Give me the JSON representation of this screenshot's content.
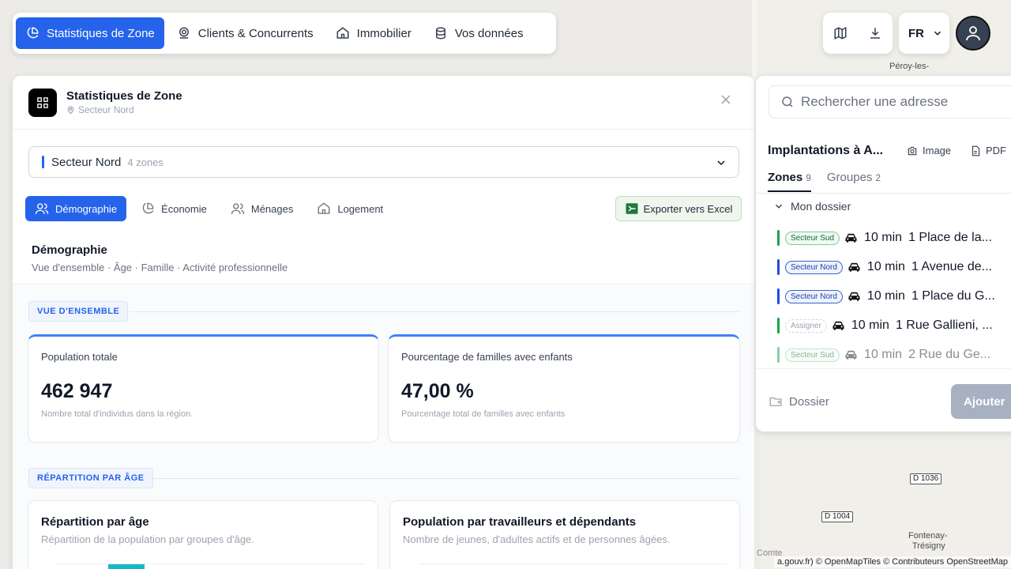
{
  "nav": {
    "items": [
      {
        "label": "Statistiques de Zone",
        "icon": "pie-chart-icon",
        "active": true
      },
      {
        "label": "Clients & Concurrents",
        "icon": "map-pin-icon",
        "active": false
      },
      {
        "label": "Immobilier",
        "icon": "home-icon",
        "active": false
      },
      {
        "label": "Vos données",
        "icon": "database-icon",
        "active": false
      }
    ]
  },
  "toolbar": {
    "map_icon": "map-icon",
    "download_icon": "download-icon",
    "language": "FR",
    "user_icon": "user-icon"
  },
  "panel": {
    "title": "Statistiques de Zone",
    "subtitle": "Secteur Nord",
    "zone_select": {
      "name": "Secteur Nord",
      "count": "4 zones"
    },
    "tabs": [
      {
        "label": "Démographie",
        "icon": "users-icon",
        "active": true
      },
      {
        "label": "Économie",
        "icon": "pie-chart-icon",
        "active": false
      },
      {
        "label": "Ménages",
        "icon": "users-icon",
        "active": false
      },
      {
        "label": "Logement",
        "icon": "home-icon",
        "active": false
      }
    ],
    "export_label": "Exporter vers Excel",
    "section": {
      "title": "Démographie",
      "subtitle": "Vue d'ensemble · Âge · Famille · Activité professionnelle"
    },
    "overview_chip": "VUE D'ENSEMBLE",
    "cards": [
      {
        "label": "Population totale",
        "value": "462 947",
        "desc": "Nombre total d'individus dans la région."
      },
      {
        "label": "Pourcentage de familles avec enfants",
        "value": "47,00 %",
        "desc": "Pourcentage total de familles avec enfants"
      }
    ],
    "age_chip": "RÉPARTITION PAR ÂGE",
    "charts": [
      {
        "title": "Répartition par âge",
        "subtitle": "Répartition de la population par groupes d'âge."
      },
      {
        "title": "Population par travailleurs et dépendants",
        "subtitle": "Nombre de jeunes, d'adultes actifs et de personnes âgées."
      }
    ]
  },
  "sidebar": {
    "search_placeholder": "Rechercher une adresse",
    "title": "Implantations à A...",
    "image_label": "Image",
    "pdf_label": "PDF",
    "tabs": [
      {
        "label": "Zones",
        "count": "9",
        "active": true
      },
      {
        "label": "Groupes",
        "count": "2",
        "active": false
      }
    ],
    "folder": "Mon dossier",
    "rows": [
      {
        "badge": "Secteur Sud",
        "kind": "sud",
        "bar": "#16a34a",
        "time": "10 min",
        "address": "1 Place de la..."
      },
      {
        "badge": "Secteur Nord",
        "kind": "nord",
        "bar": "#1d4ed8",
        "time": "10 min",
        "address": "1 Avenue de..."
      },
      {
        "badge": "Secteur Nord",
        "kind": "nord",
        "bar": "#1d4ed8",
        "time": "10 min",
        "address": "1 Place du G..."
      },
      {
        "badge": "Assigner",
        "kind": "assign",
        "bar": "#16a34a",
        "time": "10 min",
        "address": "1 Rue Gallieni, ..."
      },
      {
        "badge": "Secteur Sud",
        "kind": "sud",
        "bar": "#16a34a",
        "time": "10 min",
        "address": "2 Rue du Ge..."
      }
    ],
    "dossier_label": "Dossier",
    "add_label": "Ajouter"
  },
  "map": {
    "labels": [
      "Péroy-les-",
      "Fontenay-",
      "Trésigny",
      "Comte"
    ],
    "roads": [
      "D 1036",
      "D 1004"
    ],
    "attribution": "a.gouv.fr) © OpenMapTiles © Contributeurs OpenStreetMap"
  },
  "colors": {
    "accent": "#2563eb",
    "excel_green": "#1d7a3a"
  }
}
